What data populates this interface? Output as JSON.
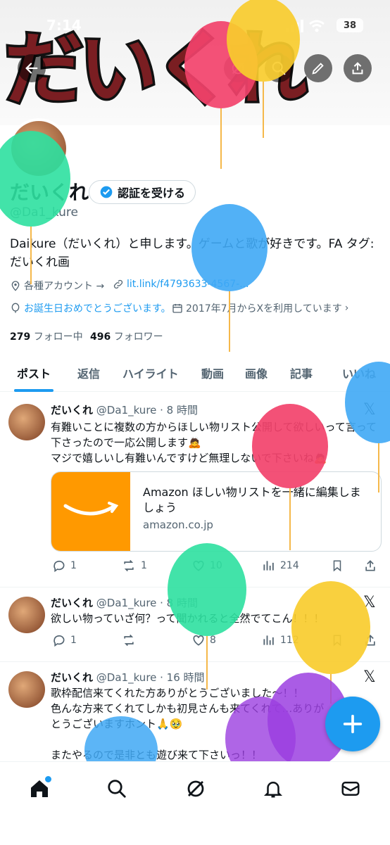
{
  "status_bar": {
    "time": "7:14",
    "battery": "38"
  },
  "header": {
    "banner_text": "だいくれ",
    "back_icon": "arrow-left-icon",
    "grok_icon": "grok-icon",
    "search_icon": "search-icon",
    "edit_icon": "pencil-icon",
    "share_icon": "share-icon"
  },
  "profile": {
    "display_name": "だいくれ",
    "verify_label": "認証を受ける",
    "handle": "@Da1_kure",
    "bio": "Daikure（だいくれ）と申します。ゲームと歌が好きです。FA タグ:だいくれ画",
    "accounts_label": "各種アカウント →",
    "link": "lit.link/f4793633-4567-...",
    "birthday": "お誕生日おめでとうございます。",
    "joined": "2017年7月からXを利用しています",
    "following_count": "279",
    "following_label": "フォロー中",
    "followers_count": "496",
    "followers_label": "フォロワー"
  },
  "tabs": [
    "ポスト",
    "返信",
    "ハイライト",
    "動画",
    "画像",
    "記事",
    "いいね"
  ],
  "tweets": [
    {
      "name": "だいくれ",
      "meta": "@Da1_kure · 8 時間",
      "text1": "有難いことに複数の方からほしい物リスト公開して欲しいって言って下さったので一応公開します🙇",
      "text2": "マジで嬉しいし有難いんですけど無理しないで下さいね🙇",
      "card_title": "Amazon ほしい物リストを一緒に編集しましょう",
      "card_domain": "amazon.co.jp",
      "replies": "1",
      "retweets": "1",
      "likes": "10",
      "views": "214"
    },
    {
      "name": "だいくれ",
      "meta": "@Da1_kure · 8 時間",
      "text1": "欲しい物っていざ何？って聞かれると全然でてこん！！！",
      "replies": "1",
      "retweets": "",
      "likes": "8",
      "views": "112"
    },
    {
      "name": "だいくれ",
      "meta": "@Da1_kure · 16 時間",
      "text1": "歌枠配信来てくれた方ありがとうございました〜！！",
      "text2": "色んな方来てくれてしかも初見さんも来てくれて…ありがとうございますホント🙏🥹",
      "text3": "またやるので是非とも遊び来て下さいっ！！"
    }
  ],
  "nav": [
    "home-icon",
    "search-icon",
    "grok-icon",
    "bell-icon",
    "mail-icon"
  ],
  "colors": {
    "accent": "#1d9bf0",
    "amazon": "#ff9900"
  }
}
